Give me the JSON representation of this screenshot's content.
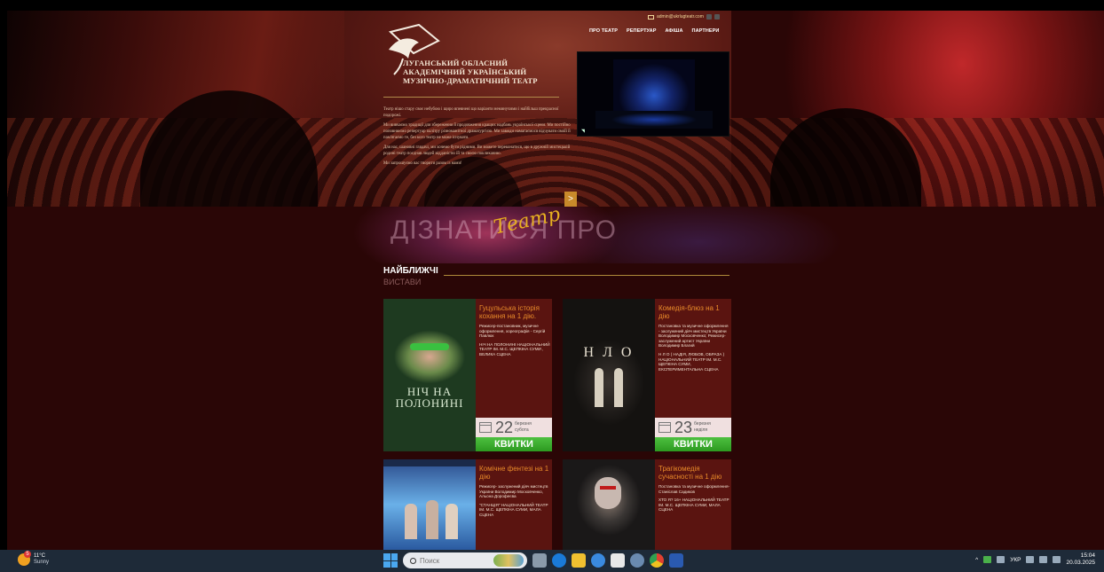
{
  "header": {
    "email": "admin@ukrlugteatr.com",
    "nav": [
      "ПРО ТЕАТР",
      "РЕПЕРТУАР",
      "АФІША",
      "ПАРТНЕРИ"
    ],
    "theatre_name_lines": [
      "ЛУГАНСЬКИЙ ОБЛАСНИЙ",
      "АКАДЕМІЧНИЙ УКРАЇНСЬКИЙ",
      "МУЗИЧНО-ДРАМАТИЧНИЙ ТЕАТР"
    ],
    "about_paragraphs": [
      "Театр нішо стару своє небубою і щиро впевнені що варіанти неминучими і найбільш прекрасної подорожі.",
      "Ми вивчаємо традиції для збереження й продовження кращих надбань української сцени. Ми постійно поповнюємо репертуар палітру різноманітної драматургією. Ми завжди намагаємося відчувати своїй й пам'ятаємо те, без кого театр не може існувати.",
      "Для нас, шановні глядачі, ми хочемо бути рідними. Ви можете переконатися, що в дружній мистецькій родині театр поєднав людей відданістю їй та своєю покликанню.",
      "Ми запрошуємо вас творити разом із нами!"
    ],
    "arrow": ">"
  },
  "learn_banner": {
    "text": "ДІЗНАТИСЯ ПРО",
    "script": "Театр"
  },
  "upcoming": {
    "title": "НАЙБЛИЖЧІ",
    "subtitle": "ВИСТАВИ",
    "cards": [
      {
        "title": "Гуцульська історія кохання на 1 дію.",
        "desc": "Режисер-постановник, музичне оформлення, хореографія - Сергій Павлюк",
        "venue": "НІЧ НА ПОЛОНИНІ НАЦІОНАЛЬНИЙ ТЕАТР ІМ. М.С. ЩЕПКІНА СУМИ , ВЕЛИКА СЦЕНА",
        "poster_title": "НІЧ НА ПОЛОНИНІ",
        "day": "22",
        "month": "березня",
        "weekday": "субота",
        "ticket": "КВИТКИ"
      },
      {
        "title": "Комедія-блюз на 1 дію",
        "desc": "Постановка та музичне оформлення - заслужений діяч мистецтв України Володимир Московченко; Режисер-заслужений артист України Володимир Благий",
        "venue": "Н Л О ( НАДІЯ, ЛЮБОВ, ОБРАЗА ) НАЦІОНАЛЬНИЙ ТЕАТР ІМ. М.С. ЩЕПКІНА СУМИ, ЕКСПЕРИМЕНТАЛЬНА СЦЕНА",
        "poster_title": "Н Л О",
        "day": "23",
        "month": "березня",
        "weekday": "неділя",
        "ticket": "КВИТКИ"
      },
      {
        "title": "Комічне фентезі на 1 дію",
        "desc": "Режисер- заслужений діяч мистецтв України Володимир Московченко, Альона Дорофеєва",
        "venue": "\"СТАНЦІЯ\" НАЦІОНАЛЬНИЙ ТЕАТР ІМ. М.С. ЩЕПКІНА СУМИ, МАЛА СЦЕНА"
      },
      {
        "title": "Трагікомедія сучасності на 1 дію",
        "desc": "Постановка та музичне оформлення- Станіслав Садиков",
        "venue": "ХТО Я? 16+ НАЦІОНАЛЬНИЙ ТЕАТР ІМ. М.С. ЩЕПКІНА СУМИ, МАЛА СЦЕНА"
      }
    ]
  },
  "taskbar": {
    "weather_temp": "11°C",
    "weather_text": "Sunny",
    "weather_badge": "5",
    "search_placeholder": "Поиск",
    "lang": "УКР",
    "time": "15:04",
    "date": "20.03.2025"
  },
  "colors": {
    "accent": "#e88a2a",
    "ticket_green": "#3bb030",
    "card_bg": "#5a1410"
  }
}
